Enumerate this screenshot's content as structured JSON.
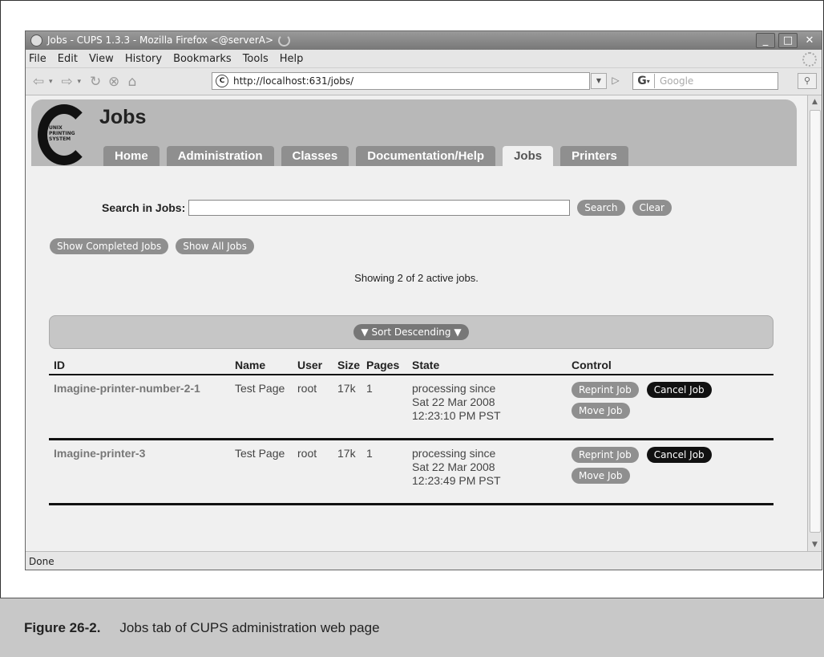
{
  "window": {
    "title": "Jobs - CUPS 1.3.3 - Mozilla Firefox <@serverA>",
    "minimize_icon": "minimize-icon",
    "maximize_icon": "maximize-icon",
    "close_icon": "close-icon"
  },
  "menubar": {
    "items": [
      "File",
      "Edit",
      "View",
      "History",
      "Bookmarks",
      "Tools",
      "Help"
    ]
  },
  "navbar": {
    "url": "http://localhost:631/jobs/",
    "search_placeholder": "Google",
    "search_engine_glyph": "G"
  },
  "page": {
    "title": "Jobs",
    "logo_text": [
      "UNIX",
      "PRINTING",
      "SYSTEM"
    ],
    "tabs": [
      {
        "label": "Home",
        "active": false
      },
      {
        "label": "Administration",
        "active": false
      },
      {
        "label": "Classes",
        "active": false
      },
      {
        "label": "Documentation/Help",
        "active": false
      },
      {
        "label": "Jobs",
        "active": true
      },
      {
        "label": "Printers",
        "active": false
      }
    ],
    "search": {
      "label": "Search in Jobs:",
      "value": "",
      "search_button": "Search",
      "clear_button": "Clear"
    },
    "show_completed_button": "Show Completed Jobs",
    "show_all_button": "Show All Jobs",
    "summary": "Showing 2 of 2 active jobs.",
    "sort_button": "▼ Sort Descending ▼"
  },
  "table": {
    "headers": [
      "ID",
      "Name",
      "User",
      "Size",
      "Pages",
      "State",
      "Control"
    ],
    "rows": [
      {
        "id": "Imagine-printer-number-2-1",
        "name": "Test Page",
        "user": "root",
        "size": "17k",
        "pages": "1",
        "state": [
          "processing since",
          "Sat 22 Mar 2008",
          "12:23:10 PM PST"
        ],
        "reprint": "Reprint Job",
        "cancel": "Cancel Job",
        "move": "Move Job"
      },
      {
        "id": "Imagine-printer-3",
        "name": "Test Page",
        "user": "root",
        "size": "17k",
        "pages": "1",
        "state": [
          "processing since",
          "Sat 22 Mar 2008",
          "12:23:49 PM PST"
        ],
        "reprint": "Reprint Job",
        "cancel": "Cancel Job",
        "move": "Move Job"
      }
    ]
  },
  "statusbar": {
    "text": "Done"
  },
  "caption": {
    "number": "Figure 26-2.",
    "text": "Jobs tab of CUPS administration web page"
  },
  "colors": {
    "tab_bg": "#8f8f8f",
    "header_bg": "#b8b8b8",
    "content_bg": "#f0f0f0",
    "cancel_button_bg": "#111111"
  }
}
